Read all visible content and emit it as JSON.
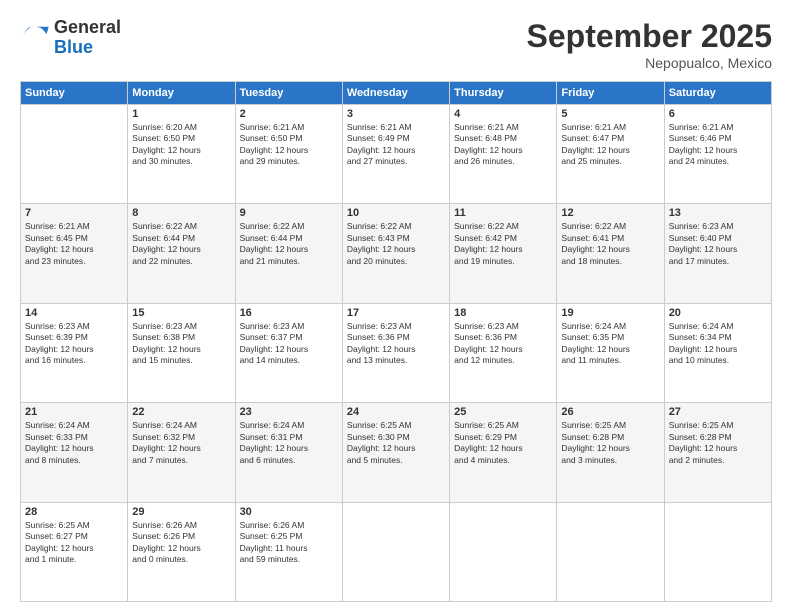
{
  "header": {
    "logo_general": "General",
    "logo_blue": "Blue",
    "month": "September 2025",
    "location": "Nepopualco, Mexico"
  },
  "days_of_week": [
    "Sunday",
    "Monday",
    "Tuesday",
    "Wednesday",
    "Thursday",
    "Friday",
    "Saturday"
  ],
  "weeks": [
    [
      {
        "day": "",
        "info": ""
      },
      {
        "day": "1",
        "info": "Sunrise: 6:20 AM\nSunset: 6:50 PM\nDaylight: 12 hours\nand 30 minutes."
      },
      {
        "day": "2",
        "info": "Sunrise: 6:21 AM\nSunset: 6:50 PM\nDaylight: 12 hours\nand 29 minutes."
      },
      {
        "day": "3",
        "info": "Sunrise: 6:21 AM\nSunset: 6:49 PM\nDaylight: 12 hours\nand 27 minutes."
      },
      {
        "day": "4",
        "info": "Sunrise: 6:21 AM\nSunset: 6:48 PM\nDaylight: 12 hours\nand 26 minutes."
      },
      {
        "day": "5",
        "info": "Sunrise: 6:21 AM\nSunset: 6:47 PM\nDaylight: 12 hours\nand 25 minutes."
      },
      {
        "day": "6",
        "info": "Sunrise: 6:21 AM\nSunset: 6:46 PM\nDaylight: 12 hours\nand 24 minutes."
      }
    ],
    [
      {
        "day": "7",
        "info": "Sunrise: 6:21 AM\nSunset: 6:45 PM\nDaylight: 12 hours\nand 23 minutes."
      },
      {
        "day": "8",
        "info": "Sunrise: 6:22 AM\nSunset: 6:44 PM\nDaylight: 12 hours\nand 22 minutes."
      },
      {
        "day": "9",
        "info": "Sunrise: 6:22 AM\nSunset: 6:44 PM\nDaylight: 12 hours\nand 21 minutes."
      },
      {
        "day": "10",
        "info": "Sunrise: 6:22 AM\nSunset: 6:43 PM\nDaylight: 12 hours\nand 20 minutes."
      },
      {
        "day": "11",
        "info": "Sunrise: 6:22 AM\nSunset: 6:42 PM\nDaylight: 12 hours\nand 19 minutes."
      },
      {
        "day": "12",
        "info": "Sunrise: 6:22 AM\nSunset: 6:41 PM\nDaylight: 12 hours\nand 18 minutes."
      },
      {
        "day": "13",
        "info": "Sunrise: 6:23 AM\nSunset: 6:40 PM\nDaylight: 12 hours\nand 17 minutes."
      }
    ],
    [
      {
        "day": "14",
        "info": "Sunrise: 6:23 AM\nSunset: 6:39 PM\nDaylight: 12 hours\nand 16 minutes."
      },
      {
        "day": "15",
        "info": "Sunrise: 6:23 AM\nSunset: 6:38 PM\nDaylight: 12 hours\nand 15 minutes."
      },
      {
        "day": "16",
        "info": "Sunrise: 6:23 AM\nSunset: 6:37 PM\nDaylight: 12 hours\nand 14 minutes."
      },
      {
        "day": "17",
        "info": "Sunrise: 6:23 AM\nSunset: 6:36 PM\nDaylight: 12 hours\nand 13 minutes."
      },
      {
        "day": "18",
        "info": "Sunrise: 6:23 AM\nSunset: 6:36 PM\nDaylight: 12 hours\nand 12 minutes."
      },
      {
        "day": "19",
        "info": "Sunrise: 6:24 AM\nSunset: 6:35 PM\nDaylight: 12 hours\nand 11 minutes."
      },
      {
        "day": "20",
        "info": "Sunrise: 6:24 AM\nSunset: 6:34 PM\nDaylight: 12 hours\nand 10 minutes."
      }
    ],
    [
      {
        "day": "21",
        "info": "Sunrise: 6:24 AM\nSunset: 6:33 PM\nDaylight: 12 hours\nand 8 minutes."
      },
      {
        "day": "22",
        "info": "Sunrise: 6:24 AM\nSunset: 6:32 PM\nDaylight: 12 hours\nand 7 minutes."
      },
      {
        "day": "23",
        "info": "Sunrise: 6:24 AM\nSunset: 6:31 PM\nDaylight: 12 hours\nand 6 minutes."
      },
      {
        "day": "24",
        "info": "Sunrise: 6:25 AM\nSunset: 6:30 PM\nDaylight: 12 hours\nand 5 minutes."
      },
      {
        "day": "25",
        "info": "Sunrise: 6:25 AM\nSunset: 6:29 PM\nDaylight: 12 hours\nand 4 minutes."
      },
      {
        "day": "26",
        "info": "Sunrise: 6:25 AM\nSunset: 6:28 PM\nDaylight: 12 hours\nand 3 minutes."
      },
      {
        "day": "27",
        "info": "Sunrise: 6:25 AM\nSunset: 6:28 PM\nDaylight: 12 hours\nand 2 minutes."
      }
    ],
    [
      {
        "day": "28",
        "info": "Sunrise: 6:25 AM\nSunset: 6:27 PM\nDaylight: 12 hours\nand 1 minute."
      },
      {
        "day": "29",
        "info": "Sunrise: 6:26 AM\nSunset: 6:26 PM\nDaylight: 12 hours\nand 0 minutes."
      },
      {
        "day": "30",
        "info": "Sunrise: 6:26 AM\nSunset: 6:25 PM\nDaylight: 11 hours\nand 59 minutes."
      },
      {
        "day": "",
        "info": ""
      },
      {
        "day": "",
        "info": ""
      },
      {
        "day": "",
        "info": ""
      },
      {
        "day": "",
        "info": ""
      }
    ]
  ]
}
